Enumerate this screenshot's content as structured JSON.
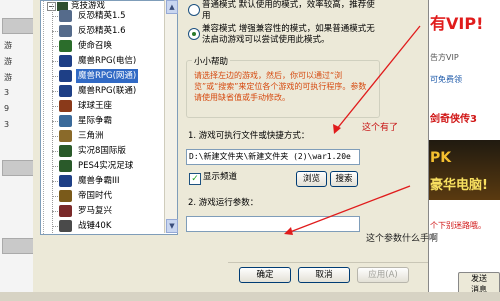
{
  "tree": {
    "header": "竞技游戏",
    "items": [
      {
        "label": "反恐精英1.5",
        "icon": "soldier-icon",
        "color": "#556b8b"
      },
      {
        "label": "反恐精英1.6",
        "icon": "soldier-icon",
        "color": "#556b8b"
      },
      {
        "label": "使命召唤",
        "icon": "soldier-icon",
        "color": "#2b6d2b"
      },
      {
        "label": "魔兽RPG(电信)",
        "icon": "warcraft-icon",
        "color": "#1e3f86"
      },
      {
        "label": "魔兽RPG(网通)",
        "icon": "warcraft-icon",
        "color": "#1e3f86",
        "selected": true
      },
      {
        "label": "魔兽RPG(联通)",
        "icon": "warcraft-icon",
        "color": "#1e3f86"
      },
      {
        "label": "球球王座",
        "icon": "game-icon",
        "color": "#8a3a1a"
      },
      {
        "label": "星际争霸",
        "icon": "starcraft-icon",
        "color": "#3a6a9a"
      },
      {
        "label": "三角洲",
        "icon": "delta-icon",
        "color": "#8a6a2a"
      },
      {
        "label": "实况8国际版",
        "icon": "soccer-icon",
        "color": "#2a5a2a"
      },
      {
        "label": "PES4实况足球",
        "icon": "soccer-icon",
        "color": "#2a5a2a"
      },
      {
        "label": "魔兽争霸III",
        "icon": "warcraft-icon",
        "color": "#1e3f86"
      },
      {
        "label": "帝国时代",
        "icon": "empire-icon",
        "color": "#7a5a1a"
      },
      {
        "label": "罗马复兴",
        "icon": "rome-icon",
        "color": "#7a2a2a"
      },
      {
        "label": "战锤40K",
        "icon": "warhammer-icon",
        "color": "#4a4a4a"
      }
    ]
  },
  "panel": {
    "mode_normal_text": "普通模式  默认使用的模式，效率较高，推荐使用",
    "mode_compat_text": "兼容模式  增强兼容性的模式，如果普通模式无法启动游戏可以尝试使用此模式。",
    "help_title": "小小帮助",
    "help_text": "请选择左边的游戏，然后，你可以通过“浏览”或“搜索”来定位各个游戏的可执行程序。参数请使用缺省值或手动修改。",
    "step1_label": "1. 游戏可执行文件或快捷方式：",
    "exe_path": "D:\\新建文件夹\\新建文件夹 (2)\\war1.20e",
    "show_channel_label": "显示频道",
    "show_channel_checked": true,
    "browse_label": "浏览",
    "search_label": "搜索",
    "step2_label": "2. 游戏运行参数：",
    "params_value": ""
  },
  "footer": {
    "ok_label": "确定",
    "cancel_label": "取消",
    "apply_label": "应用(A)"
  },
  "annotations": {
    "this_one": "这个有了",
    "what_param": "这个参数什么手啊"
  },
  "background": {
    "vip_text": "有VIP!",
    "line1": "告方VIP",
    "line2": "可免费领",
    "line3": "剑奇侠传3",
    "banner": "豪华电脑!",
    "banner_prefix": "PK",
    "line4": "个下别迷路哦。",
    "send_label": "发送",
    "send_sub": "消息",
    "bg_left_cells": [
      "游",
      "游",
      "游",
      "3",
      "9",
      "3"
    ]
  }
}
